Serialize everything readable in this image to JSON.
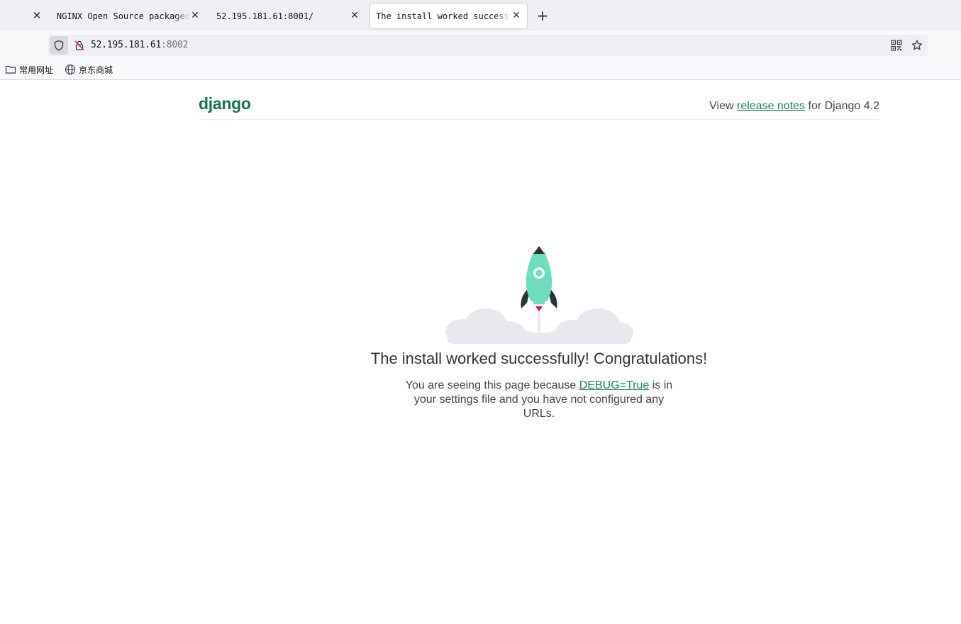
{
  "browser": {
    "tabs": [
      {
        "title": "NGINX Open Source packaged by Bitnami",
        "active": false
      },
      {
        "title": "52.195.181.61:8001/",
        "active": false
      },
      {
        "title": "The install worked successfully! Congratulations!",
        "active": true
      }
    ],
    "url": {
      "host": "52.195.181.61",
      "port": ":8002"
    },
    "bookmarks": [
      {
        "label": "常用网址",
        "icon": "folder-icon"
      },
      {
        "label": "京东商城",
        "icon": "globe-icon"
      }
    ]
  },
  "page": {
    "logo": "django",
    "release": {
      "prefix": "View ",
      "link": "release notes",
      "suffix": " for Django 4.2"
    },
    "headline": "The install worked successfully! Congratulations!",
    "body": {
      "prefix": "You are seeing this page because ",
      "link": "DEBUG=True",
      "suffix": " is in your settings file and you have not configured any URLs."
    }
  },
  "colors": {
    "django_green": "#18734c",
    "link_green": "#19865c",
    "rocket_body": "#6dddbd",
    "rocket_dark": "#2d3436",
    "flame": "#c01f4f",
    "cloud": "#e8e9ee"
  }
}
